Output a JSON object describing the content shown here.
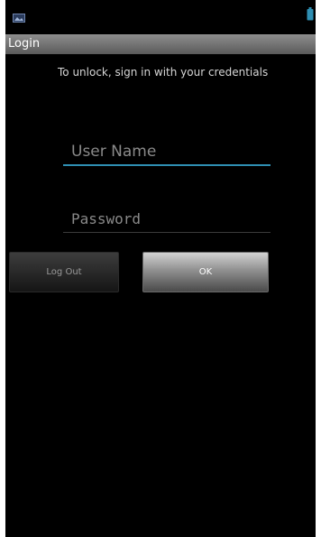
{
  "status_bar": {
    "notification_icon": "image-notification-icon",
    "battery_icon": "battery-icon"
  },
  "title_bar": {
    "title": "Login"
  },
  "login": {
    "instructions": "To unlock, sign in with your credentials",
    "username_placeholder": "User Name",
    "password_placeholder": "Password",
    "logout_label": "Log Out",
    "ok_label": "OK"
  },
  "colors": {
    "background": "#000000",
    "title_bar": "#767676",
    "focused_underline": "#2f8fb3",
    "placeholder_text": "#8a8a8a"
  }
}
